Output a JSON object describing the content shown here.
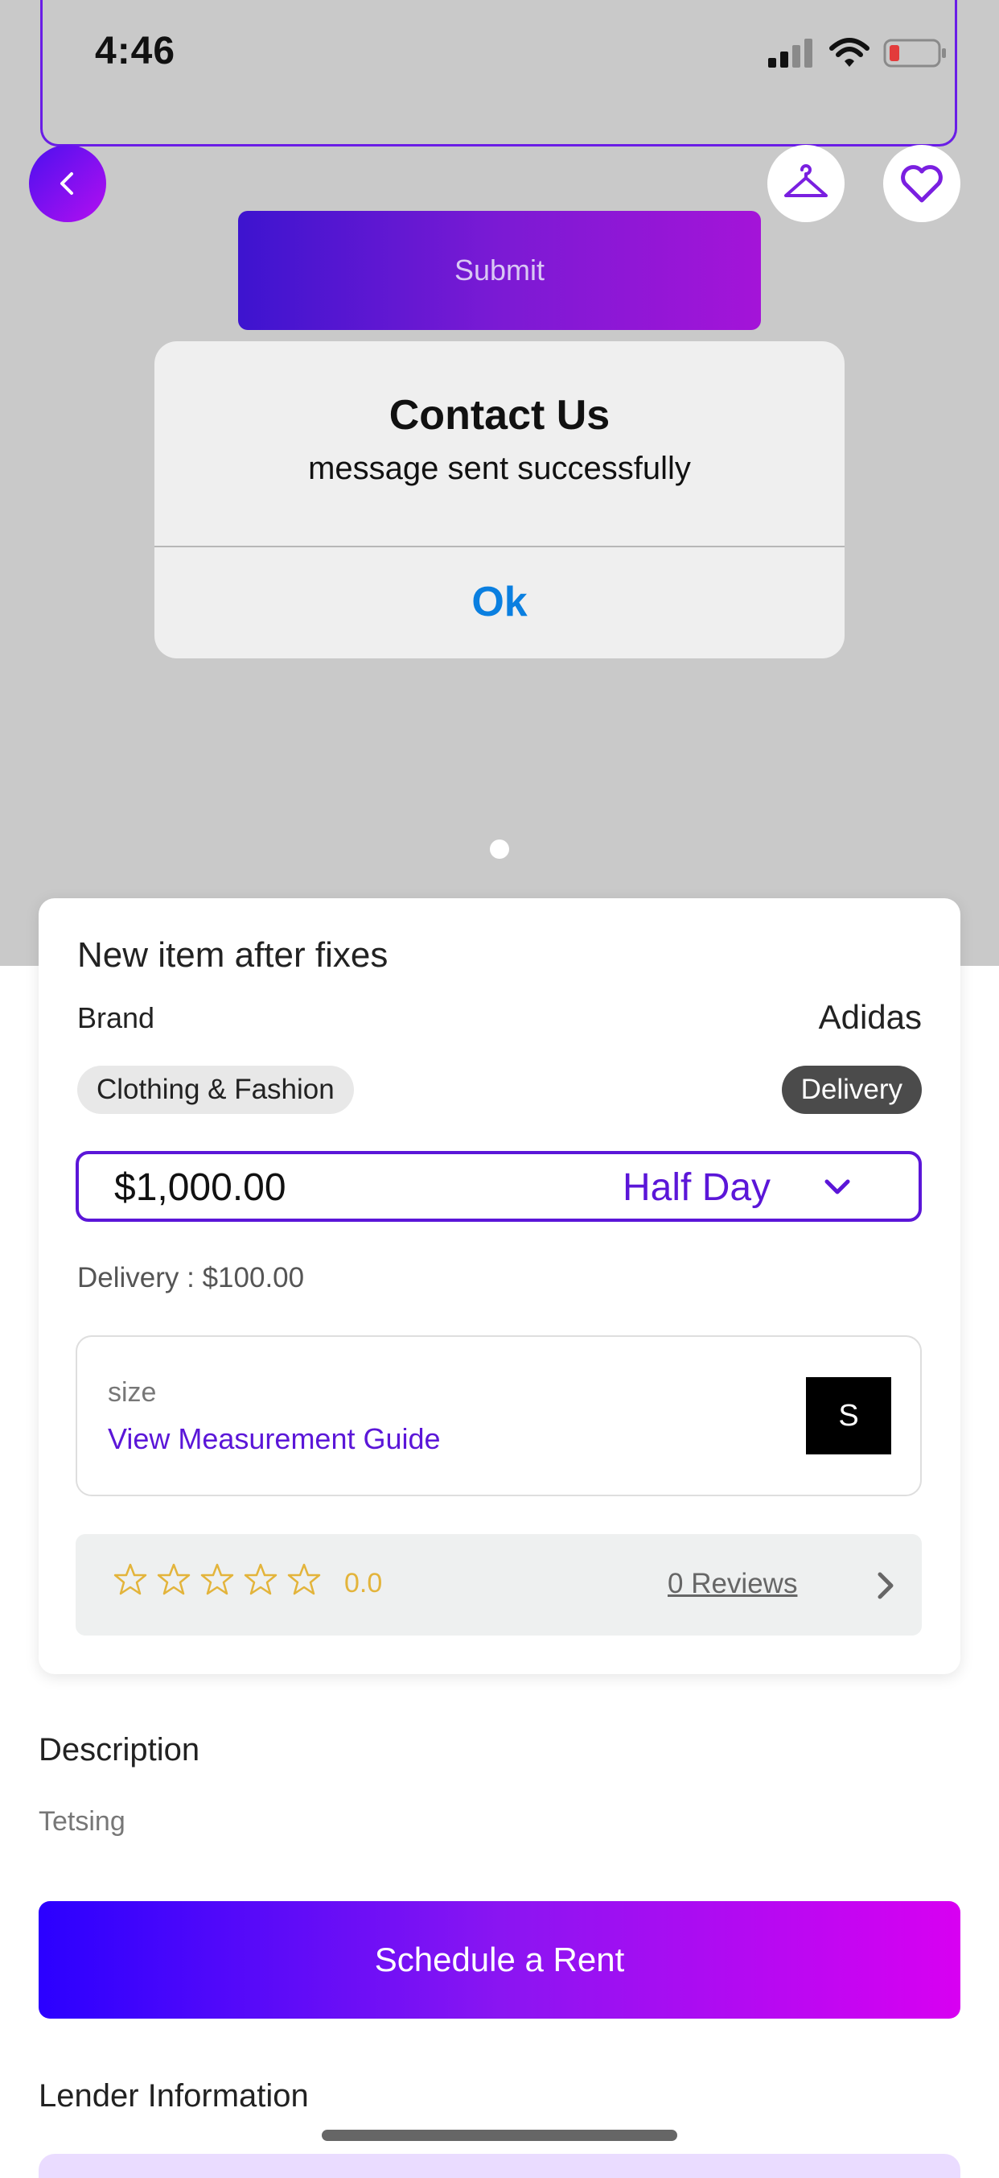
{
  "status_bar": {
    "time": "4:46",
    "icons": [
      "signal-icon",
      "wifi-icon",
      "battery-low-icon"
    ],
    "battery_color": "#e33b3b"
  },
  "header": {
    "back_icon": "chevron-left-icon",
    "hanger_icon": "hanger-icon",
    "favorite_icon": "heart-outline-icon"
  },
  "background_form": {
    "submit_label": "Submit"
  },
  "alert": {
    "title": "Contact Us",
    "message": "message sent successfully",
    "ok_label": "Ok"
  },
  "product": {
    "title": "New item after fixes",
    "brand_label": "Brand",
    "brand_value": "Adidas",
    "category": "Clothing & Fashion",
    "delivery_badge": "Delivery",
    "price": "$1,000.00",
    "duration": "Half Day",
    "delivery_fee": "Delivery : $100.00",
    "size_label": "size",
    "size_guide_link": "View Measurement Guide",
    "size_value": "S",
    "rating_value": "0.0",
    "rating_stars": 0,
    "reviews_link": "0 Reviews"
  },
  "description": {
    "heading": "Description",
    "text": "Tetsing"
  },
  "actions": {
    "schedule_label": "Schedule a Rent"
  },
  "lender": {
    "heading": "Lender Information"
  },
  "colors": {
    "accent": "#5b16d8",
    "star": "#e3b43b",
    "ok_blue": "#0a7fe0"
  }
}
